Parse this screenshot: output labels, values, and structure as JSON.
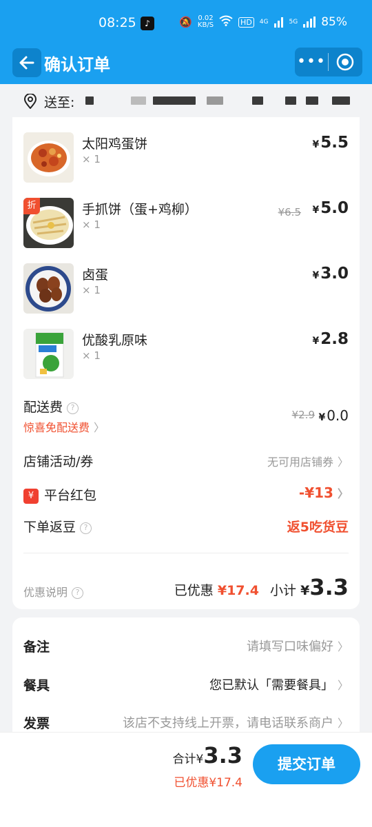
{
  "status": {
    "time": "08:25",
    "app_icon": "tiktok-icon",
    "speed_value": "0.02",
    "speed_unit": "KB/S",
    "hd": "HD",
    "net1": "4G",
    "net2": "5G",
    "battery": "85%"
  },
  "nav": {
    "title": "确认订单",
    "more": "•••"
  },
  "address": {
    "label": "送至:"
  },
  "items": [
    {
      "name": "太阳鸡蛋饼",
      "qty": "× 1",
      "yen": "¥",
      "price": "5.5"
    },
    {
      "name": "手抓饼（蛋+鸡柳）",
      "qty": "× 1",
      "yen": "¥",
      "price": "5.0",
      "orig": "¥6.5",
      "badge": "折"
    },
    {
      "name": "卤蛋",
      "qty": "× 1",
      "yen": "¥",
      "price": "3.0"
    },
    {
      "name": "优酸乳原味",
      "qty": "× 1",
      "yen": "¥",
      "price": "2.8"
    }
  ],
  "delivery": {
    "label": "配送费",
    "promo": "惊喜免配送费",
    "orig": "¥2.9",
    "yen": "¥",
    "price": "0.0"
  },
  "store_coupon": {
    "label": "店铺活动/券",
    "value": "无可用店铺券"
  },
  "red_packet": {
    "icon": "¥",
    "label": "平台红包",
    "value": "-¥13"
  },
  "beans": {
    "label": "下单返豆",
    "value": "返5吃货豆"
  },
  "summary": {
    "note_label": "优惠说明",
    "discount_label": "已优惠",
    "discount_value": "¥17.4",
    "subtotal_label": "小计",
    "yen": "¥",
    "subtotal_value": "3.3"
  },
  "extras": {
    "remark_label": "备注",
    "remark_value": "请填写口味偏好",
    "utensils_label": "餐具",
    "utensils_value": "您已默认「需要餐具」",
    "invoice_label": "发票",
    "invoice_value": "该店不支持线上开票，请电话联系商户"
  },
  "footer": {
    "total_label": "合计",
    "yen": "¥",
    "total_value": "3.3",
    "saved_text": "已优惠¥17.4",
    "submit_label": "提交订单"
  },
  "colors": {
    "brand": "#1aa0f0",
    "accent_red": "#f05030"
  }
}
